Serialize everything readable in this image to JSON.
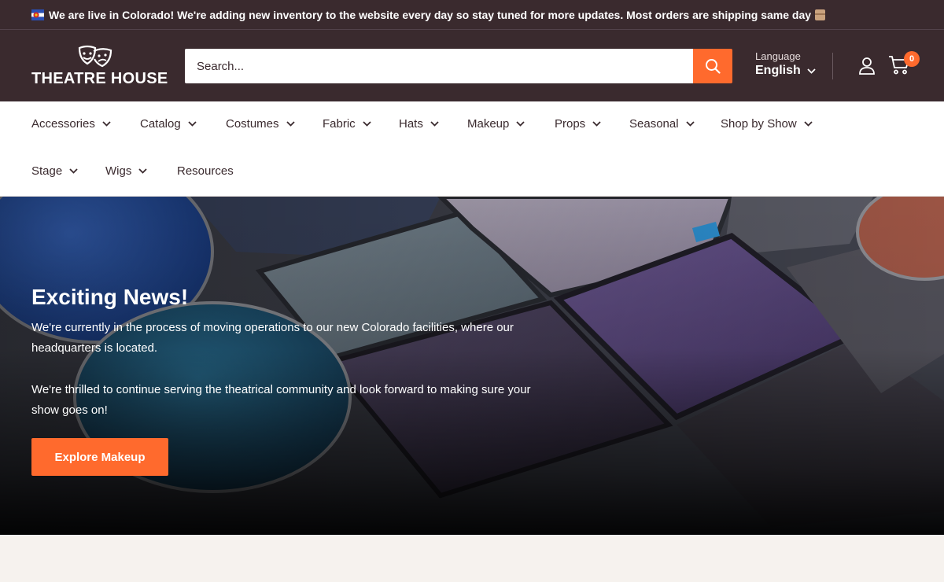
{
  "announcement": {
    "text": "We are live in Colorado! We're adding new inventory to the website every day so stay tuned for more updates. Most orders are shipping same day",
    "lead_icon": "colorado-flag-icon",
    "trail_icon": "package-icon"
  },
  "header": {
    "logo_text": "THEATRE HOUSE",
    "logo_icon": "theatre-masks-icon",
    "search_placeholder": "Search...",
    "search_icon": "search-icon",
    "language_label": "Language",
    "language_value": "English",
    "account_icon": "user-icon",
    "cart_icon": "cart-icon",
    "cart_count": "0"
  },
  "nav": {
    "items": [
      {
        "label": "Accessories",
        "dropdown": true
      },
      {
        "label": "Catalog",
        "dropdown": true
      },
      {
        "label": "Costumes",
        "dropdown": true
      },
      {
        "label": "Fabric",
        "dropdown": true
      },
      {
        "label": "Hats",
        "dropdown": true
      },
      {
        "label": "Makeup",
        "dropdown": true
      },
      {
        "label": "Props",
        "dropdown": true
      },
      {
        "label": "Seasonal",
        "dropdown": true
      },
      {
        "label": "Shop by Show",
        "dropdown": true
      },
      {
        "label": "Stage",
        "dropdown": true
      },
      {
        "label": "Wigs",
        "dropdown": true
      },
      {
        "label": "Resources",
        "dropdown": false
      }
    ]
  },
  "hero": {
    "title": "Exciting News!",
    "paragraph1": "We're currently in the process of moving operations to our new Colorado facilities, where our headquarters is located.",
    "paragraph2": "We're thrilled to continue serving the theatrical community and look forward to making sure your show goes on!",
    "button_label": "Explore Makeup",
    "background": "eyeshadow-palette-image"
  },
  "colors": {
    "header_bg": "#3a2a2e",
    "accent": "#ff6a2d",
    "page_bg": "#f6f2ee"
  }
}
